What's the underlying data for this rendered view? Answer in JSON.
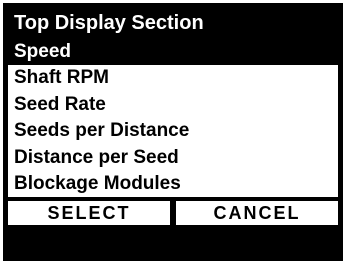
{
  "header": {
    "title": "Top Display Section"
  },
  "menu": {
    "selected_index": 0,
    "items": [
      {
        "label": "Speed"
      },
      {
        "label": "Shaft RPM"
      },
      {
        "label": "Seed Rate"
      },
      {
        "label": "Seeds per Distance"
      },
      {
        "label": "Distance per Seed"
      },
      {
        "label": "Blockage Modules"
      }
    ]
  },
  "softkeys": {
    "select_label": "SELECT",
    "cancel_label": "CANCEL"
  },
  "colors": {
    "background": "#000000",
    "foreground": "#ffffff",
    "highlight": "#000000"
  }
}
